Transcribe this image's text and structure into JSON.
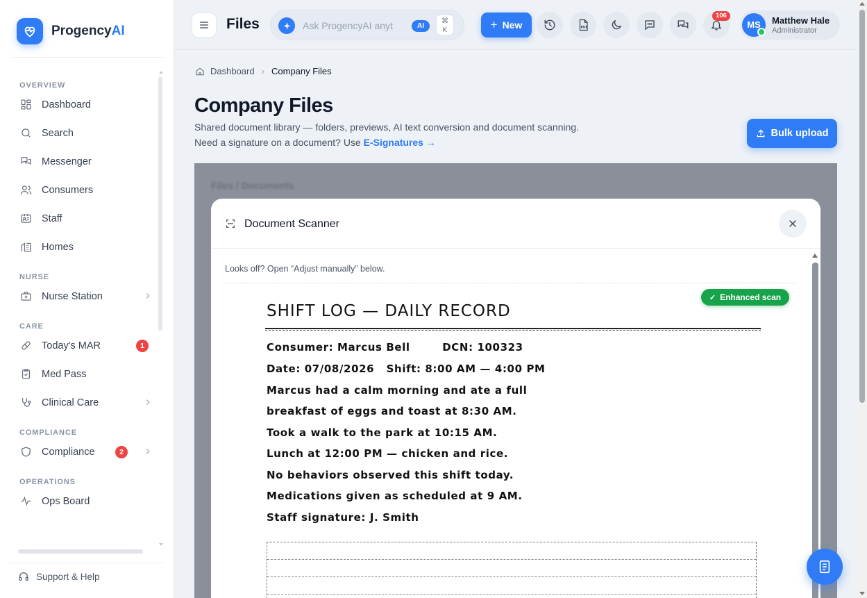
{
  "brand": {
    "name": "Progency",
    "name_accent": "AI"
  },
  "sidebar": {
    "sections": {
      "overview": "OVERVIEW",
      "nurse": "NURSE",
      "care": "CARE",
      "compliance": "COMPLIANCE",
      "operations": "OPERATIONS"
    },
    "items": {
      "dashboard": "Dashboard",
      "search": "Search",
      "messenger": "Messenger",
      "consumers": "Consumers",
      "staff": "Staff",
      "homes": "Homes",
      "nurse_station": "Nurse Station",
      "todays_mar": "Today's MAR",
      "todays_mar_badge": "1",
      "med_pass": "Med Pass",
      "clinical_care": "Clinical Care",
      "compliance": "Compliance",
      "compliance_badge": "2",
      "ops_board": "Ops Board"
    },
    "support": "Support & Help"
  },
  "topbar": {
    "title": "Files",
    "ask_placeholder": "Ask ProgencyAI anything",
    "ask_badge": "AI",
    "kbd_cmd": "⌘",
    "kbd_key": "K",
    "new_label": "New",
    "notifications_count": "106",
    "user": {
      "initials": "MS",
      "name": "Matthew Hale",
      "role": "Administrator"
    }
  },
  "main": {
    "breadcrumb": {
      "root": "Dashboard",
      "current": "Company Files"
    },
    "title": "Company Files",
    "subtitle": "Shared document library — folders, previews, AI text conversion and document scanning.",
    "signature_prompt": "Need a signature on a document? Use ",
    "signature_link": "E-Signatures",
    "signature_arrow": "→",
    "bulk_upload": "Bulk upload",
    "overlay_label": "Files / Documents"
  },
  "modal": {
    "title": "Document Scanner",
    "hint": "Looks off? Open “Adjust manually” below.",
    "enhanced_badge": "Enhanced scan",
    "document": {
      "title": "SHIFT LOG — DAILY RECORD",
      "consumer_line": "Consumer: Marcus Bell        DCN: 100323",
      "date_line": "Date: 07/08/2026   Shift: 8:00 AM — 4:00 PM",
      "lines": [
        "Marcus had a calm morning and ate a full",
        "breakfast of eggs and toast at 8:30 AM.",
        "Took a walk to the park at 10:15 AM.",
        "Lunch at 12:00 PM — chicken and rice.",
        "No behaviors observed this shift today.",
        "Medications given as scheduled at 9 AM.",
        "Staff signature: J. Smith"
      ]
    }
  },
  "colors": {
    "accent": "#2f7cf6",
    "danger": "#ef4444",
    "success": "#16a34a"
  }
}
